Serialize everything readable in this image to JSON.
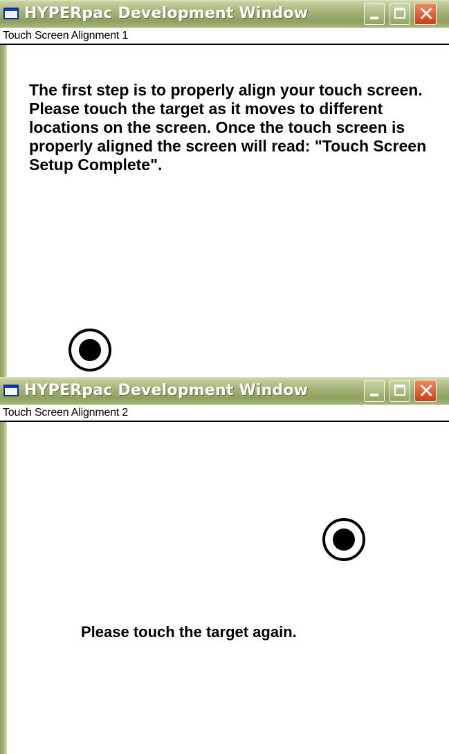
{
  "windows": [
    {
      "title": "HYPERpac Development Window",
      "subtitle": "Touch Screen Alignment 1",
      "instructions": [
        "The first step is to properly align your touch screen.",
        "Please touch the target as it moves to different locations on the screen.  Once the touch screen is properly aligned the screen will read:  \"Touch Screen Setup Complete\"."
      ]
    },
    {
      "title": "HYPERpac Development Window",
      "subtitle": "Touch Screen Alignment 2",
      "message": "Please touch the target again."
    }
  ],
  "icons": {
    "app": "window-app-icon",
    "minimize": "minimize-icon",
    "maximize": "maximize-icon",
    "close": "close-icon",
    "target": "touch-target-icon"
  },
  "colors": {
    "titlebar": "#9fb074",
    "close_button": "#cc3e13",
    "text": "#000000",
    "background": "#ffffff"
  }
}
